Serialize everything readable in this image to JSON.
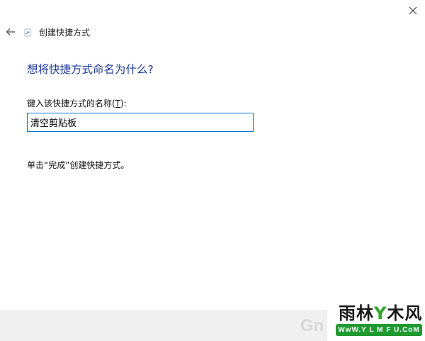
{
  "window": {
    "title": "创建快捷方式"
  },
  "main": {
    "heading": "想将快捷方式命名为什么?",
    "field_label": "键入该快捷方式的名称(",
    "field_label_hotkey": "T",
    "field_label_suffix": "):",
    "field_value": "清空剪贴板",
    "hint": "单击“完成”创建快捷方式。"
  },
  "watermark": {
    "brand_part1": "雨林",
    "brand_part2": "木风",
    "brand_mark": "Y",
    "url": "WwW.Y L M F U.CoM",
    "ghost_text": "Gn"
  },
  "icons": {
    "close": "close-icon",
    "back": "back-arrow-icon",
    "app": "shortcut-icon"
  },
  "colors": {
    "heading": "#1e3a9c",
    "input_border": "#0078d7",
    "watermark_green": "#1f9a31"
  }
}
